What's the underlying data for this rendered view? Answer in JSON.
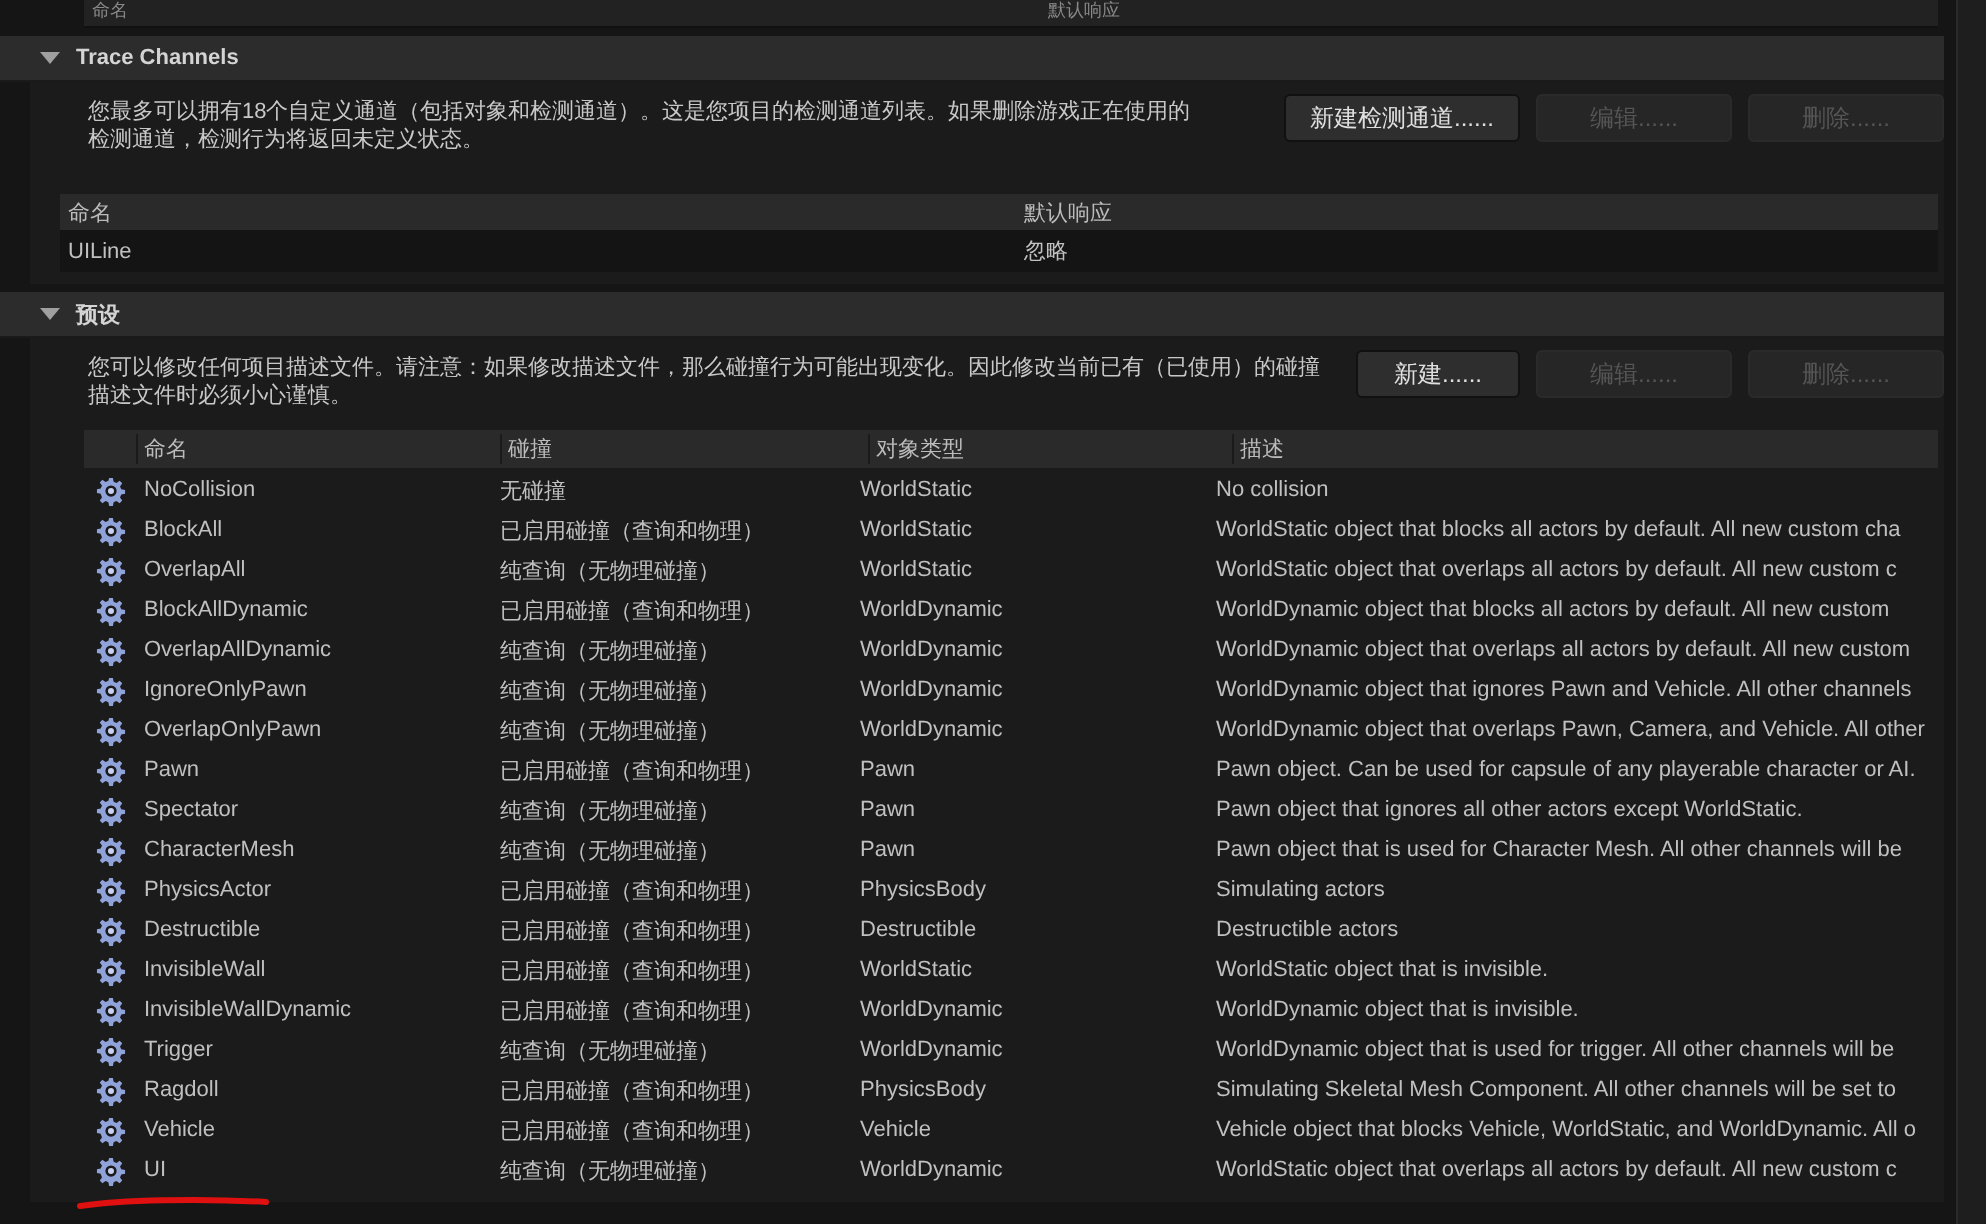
{
  "top_table": {
    "columns": [
      "命名",
      "默认响应"
    ]
  },
  "trace_channels": {
    "title": "Trace Channels",
    "expanded": true,
    "description": "您最多可以拥有18个自定义通道（包括对象和检测通道）。这是您项目的检测通道列表。如果删除游戏正在使用的检测通道，检测行为将返回未定义状态。",
    "buttons": [
      {
        "label": "新建检测通道......",
        "disabled": false
      },
      {
        "label": "编辑......",
        "disabled": true
      },
      {
        "label": "删除......",
        "disabled": true
      }
    ],
    "table": {
      "columns": [
        "命名",
        "默认响应"
      ],
      "rows": [
        {
          "name": "UILine",
          "response": "忽略"
        }
      ]
    }
  },
  "presets": {
    "title": "预设",
    "expanded": true,
    "description": "您可以修改任何项目描述文件。请注意：如果修改描述文件，那么碰撞行为可能出现变化。因此修改当前已有（已使用）的碰撞描述文件时必须小心谨慎。",
    "buttons": [
      {
        "label": "新建......",
        "disabled": false
      },
      {
        "label": "编辑......",
        "disabled": true
      },
      {
        "label": "删除......",
        "disabled": true
      }
    ],
    "table": {
      "columns": [
        "命名",
        "碰撞",
        "对象类型",
        "描述"
      ],
      "rows": [
        {
          "name": "NoCollision",
          "collision": "无碰撞",
          "object_type": "WorldStatic",
          "description": "No collision"
        },
        {
          "name": "BlockAll",
          "collision": "已启用碰撞（查询和物理）",
          "object_type": "WorldStatic",
          "description": "WorldStatic object that blocks all actors by default. All new custom cha"
        },
        {
          "name": "OverlapAll",
          "collision": "纯查询（无物理碰撞）",
          "object_type": "WorldStatic",
          "description": "WorldStatic object that overlaps all actors by default. All new custom c"
        },
        {
          "name": "BlockAllDynamic",
          "collision": "已启用碰撞（查询和物理）",
          "object_type": "WorldDynamic",
          "description": "WorldDynamic object that blocks all actors by default. All new custom"
        },
        {
          "name": "OverlapAllDynamic",
          "collision": "纯查询（无物理碰撞）",
          "object_type": "WorldDynamic",
          "description": "WorldDynamic object that overlaps all actors by default. All new custom"
        },
        {
          "name": "IgnoreOnlyPawn",
          "collision": "纯查询（无物理碰撞）",
          "object_type": "WorldDynamic",
          "description": "WorldDynamic object that ignores Pawn and Vehicle. All other channels"
        },
        {
          "name": "OverlapOnlyPawn",
          "collision": "纯查询（无物理碰撞）",
          "object_type": "WorldDynamic",
          "description": "WorldDynamic object that overlaps Pawn, Camera, and Vehicle. All other"
        },
        {
          "name": "Pawn",
          "collision": "已启用碰撞（查询和物理）",
          "object_type": "Pawn",
          "description": "Pawn object. Can be used for capsule of any playerable character or AI."
        },
        {
          "name": "Spectator",
          "collision": "纯查询（无物理碰撞）",
          "object_type": "Pawn",
          "description": "Pawn object that ignores all other actors except WorldStatic."
        },
        {
          "name": "CharacterMesh",
          "collision": "纯查询（无物理碰撞）",
          "object_type": "Pawn",
          "description": "Pawn object that is used for Character Mesh. All other channels will be"
        },
        {
          "name": "PhysicsActor",
          "collision": "已启用碰撞（查询和物理）",
          "object_type": "PhysicsBody",
          "description": "Simulating actors"
        },
        {
          "name": "Destructible",
          "collision": "已启用碰撞（查询和物理）",
          "object_type": "Destructible",
          "description": "Destructible actors"
        },
        {
          "name": "InvisibleWall",
          "collision": "已启用碰撞（查询和物理）",
          "object_type": "WorldStatic",
          "description": "WorldStatic object that is invisible."
        },
        {
          "name": "InvisibleWallDynamic",
          "collision": "已启用碰撞（查询和物理）",
          "object_type": "WorldDynamic",
          "description": "WorldDynamic object that is invisible."
        },
        {
          "name": "Trigger",
          "collision": "纯查询（无物理碰撞）",
          "object_type": "WorldDynamic",
          "description": "WorldDynamic object that is used for trigger. All other channels will be"
        },
        {
          "name": "Ragdoll",
          "collision": "已启用碰撞（查询和物理）",
          "object_type": "PhysicsBody",
          "description": "Simulating Skeletal Mesh Component. All other channels will be set to"
        },
        {
          "name": "Vehicle",
          "collision": "已启用碰撞（查询和物理）",
          "object_type": "Vehicle",
          "description": "Vehicle object that blocks Vehicle, WorldStatic, and WorldDynamic. All o"
        },
        {
          "name": "UI",
          "collision": "纯查询（无物理碰撞）",
          "object_type": "WorldDynamic",
          "description": "WorldStatic object that overlaps all actors by default. All new custom c"
        }
      ]
    }
  }
}
